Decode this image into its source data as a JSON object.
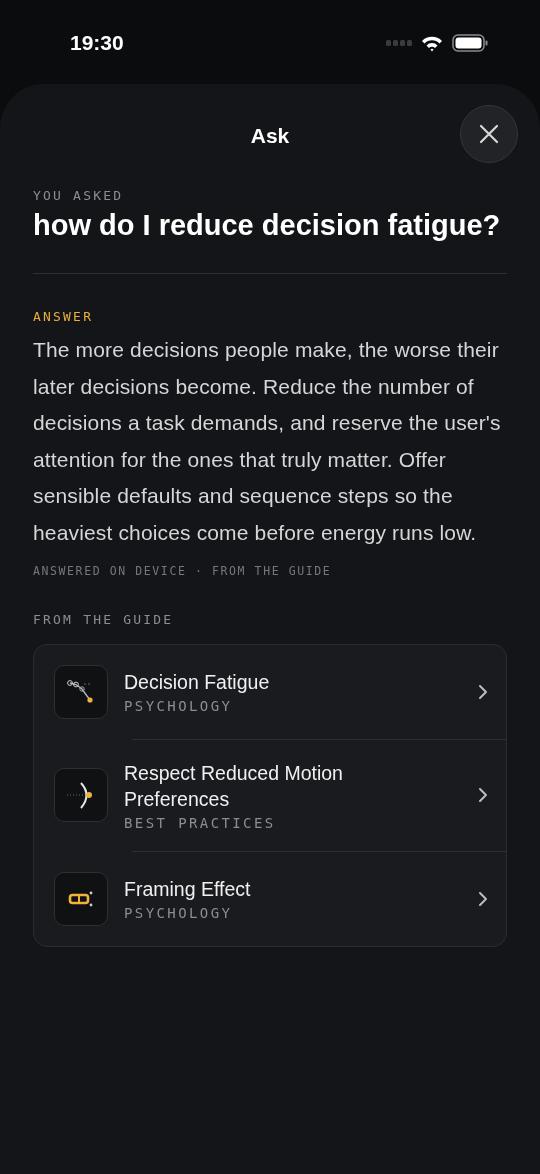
{
  "status_bar": {
    "time": "19:30"
  },
  "sheet": {
    "title": "Ask"
  },
  "question": {
    "label": "YOU ASKED",
    "text": "how do I reduce decision fatigue?"
  },
  "answer": {
    "label": "ANSWER",
    "text": "The more decisions people make, the worse their later decisions become. Reduce the number of decisions a task demands, and reserve the user's attention for the ones that truly matter. Offer sensible defaults and sequence steps so the heaviest choices come before energy runs low.",
    "meta": "ANSWERED ON DEVICE · FROM THE GUIDE"
  },
  "guide": {
    "label": "FROM THE GUIDE",
    "items": [
      {
        "title": "Decision Fatigue",
        "category": "PSYCHOLOGY"
      },
      {
        "title": "Respect Reduced Motion Preferences",
        "category": "BEST PRACTICES"
      },
      {
        "title": "Framing Effect",
        "category": "PSYCHOLOGY"
      }
    ]
  }
}
